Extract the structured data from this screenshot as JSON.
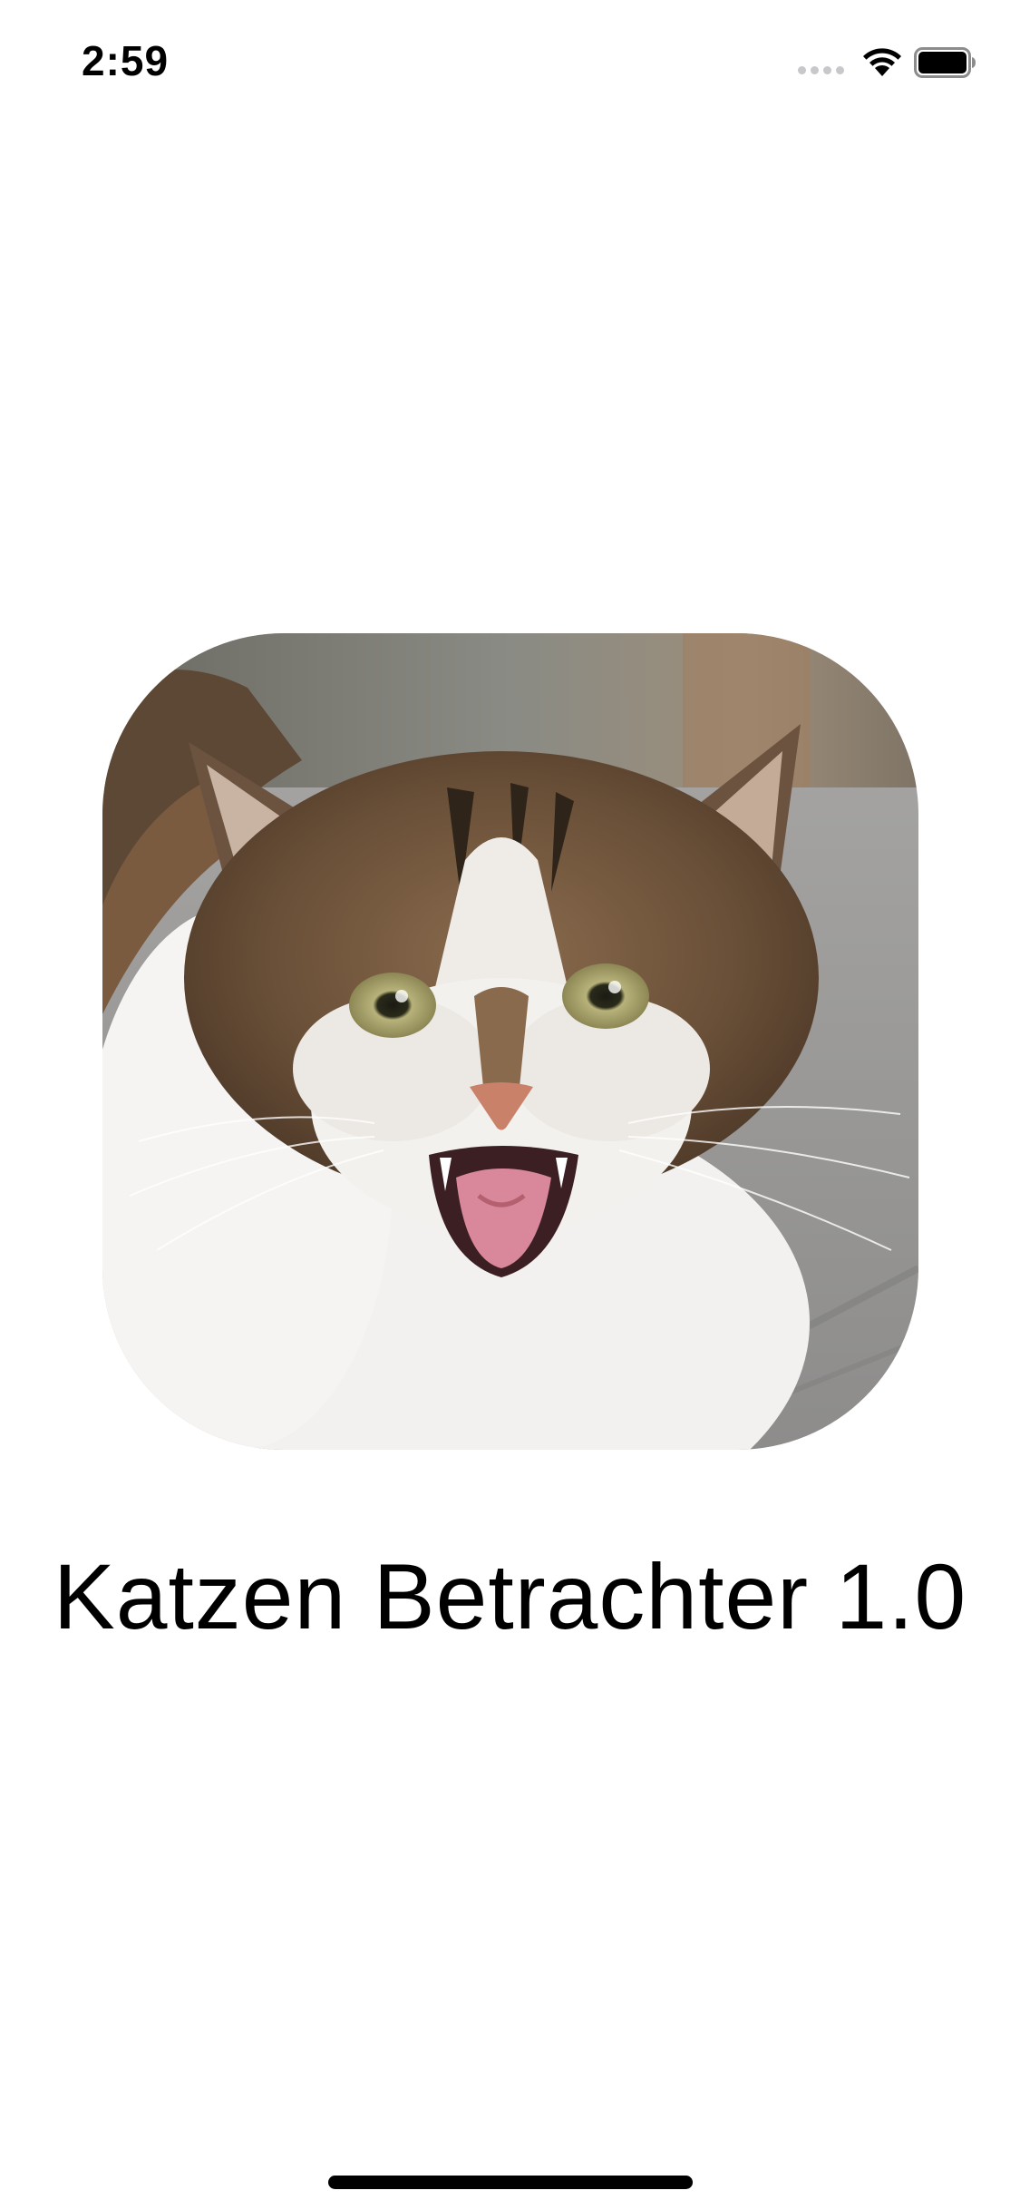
{
  "status_bar": {
    "time": "2:59",
    "signal_icon": "cellular-signal-icon",
    "wifi_icon": "wifi-icon",
    "battery_icon": "battery-icon"
  },
  "main": {
    "app_icon": "cat-photo-icon",
    "title": "Katzen Betrachter 1.0"
  },
  "colors": {
    "background": "#ffffff",
    "text": "#000000",
    "signal_inactive": "#c7c7cc"
  }
}
